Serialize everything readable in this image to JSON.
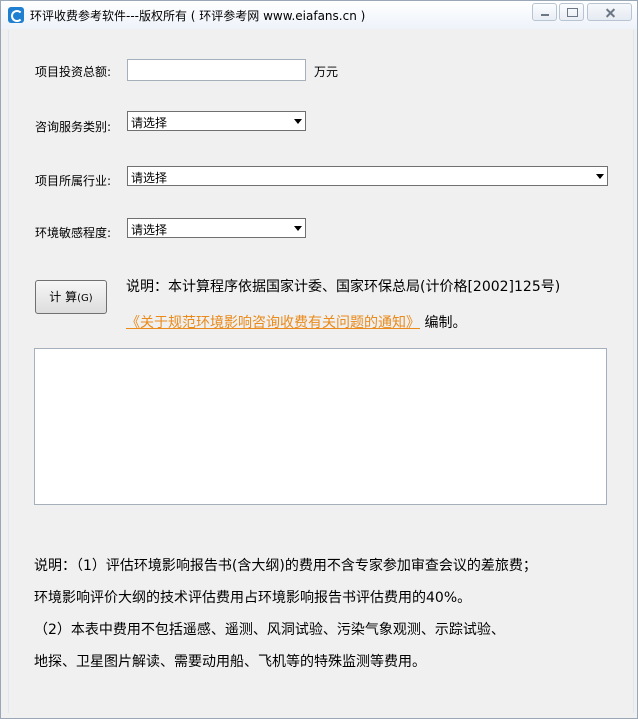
{
  "window": {
    "title": "环评收费参考软件---版权所有 ( 环评参考网 www.eiafans.cn )"
  },
  "form": {
    "investment_label": "项目投资总额:",
    "investment_value": "",
    "investment_unit": "万元",
    "service_label": "咨询服务类别:",
    "service_value": "请选择",
    "industry_label": "项目所属行业:",
    "industry_value": "请选择",
    "sensitivity_label": "环境敏感程度:",
    "sensitivity_value": "请选择"
  },
  "calc": {
    "label": "计 算",
    "accel": "(G)"
  },
  "note": {
    "text": "说明：本计算程序依据国家计委、国家环保总局(计价格[2002]125号)",
    "link": "《关于规范环境影响咨询收费有关问题的通知》",
    "suffix": " 编制。"
  },
  "result": {
    "text": ""
  },
  "footer": {
    "line1": "说明：（1）评估环境影响报告书(含大纲)的费用不含专家参加审查会议的差旅费；",
    "line2": "环境影响评价大纲的技术评估费用占环境影响报告书评估费用的40%。",
    "line3": "（2）本表中费用不包括遥感、遥测、风洞试验、污染气象观测、示踪试验、",
    "line4": "地探、卫星图片解读、需要动用船、飞机等的特殊监测等费用。"
  }
}
